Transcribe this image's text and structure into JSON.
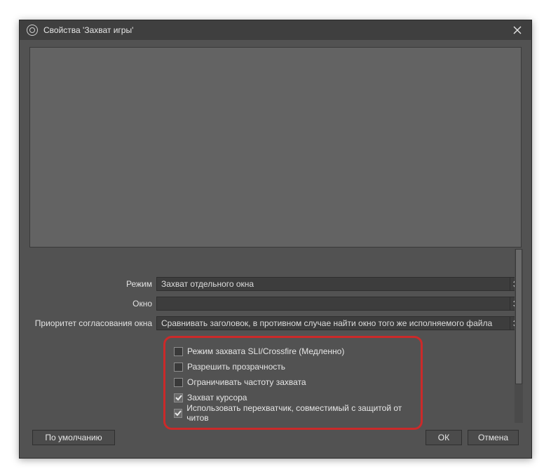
{
  "title": "Свойства 'Захват игры'",
  "rows": {
    "mode": {
      "label": "Режим",
      "value": "Захват отдельного окна"
    },
    "window": {
      "label": "Окно",
      "value": ""
    },
    "priority": {
      "label": "Приоритет согласования окна",
      "value": "Сравнивать заголовок, в противном случае найти окно того же исполняемого файла"
    }
  },
  "checks": [
    {
      "label": "Режим захвата SLI/Crossfire (Медленно)",
      "checked": false
    },
    {
      "label": "Разрешить прозрачность",
      "checked": false
    },
    {
      "label": "Ограничивать частоту захвата",
      "checked": false
    },
    {
      "label": "Захват курсора",
      "checked": true
    },
    {
      "label": "Использовать перехватчик, совместимый с защитой от читов",
      "checked": true
    }
  ],
  "buttons": {
    "defaults": "По умолчанию",
    "ok": "ОК",
    "cancel": "Отмена"
  }
}
